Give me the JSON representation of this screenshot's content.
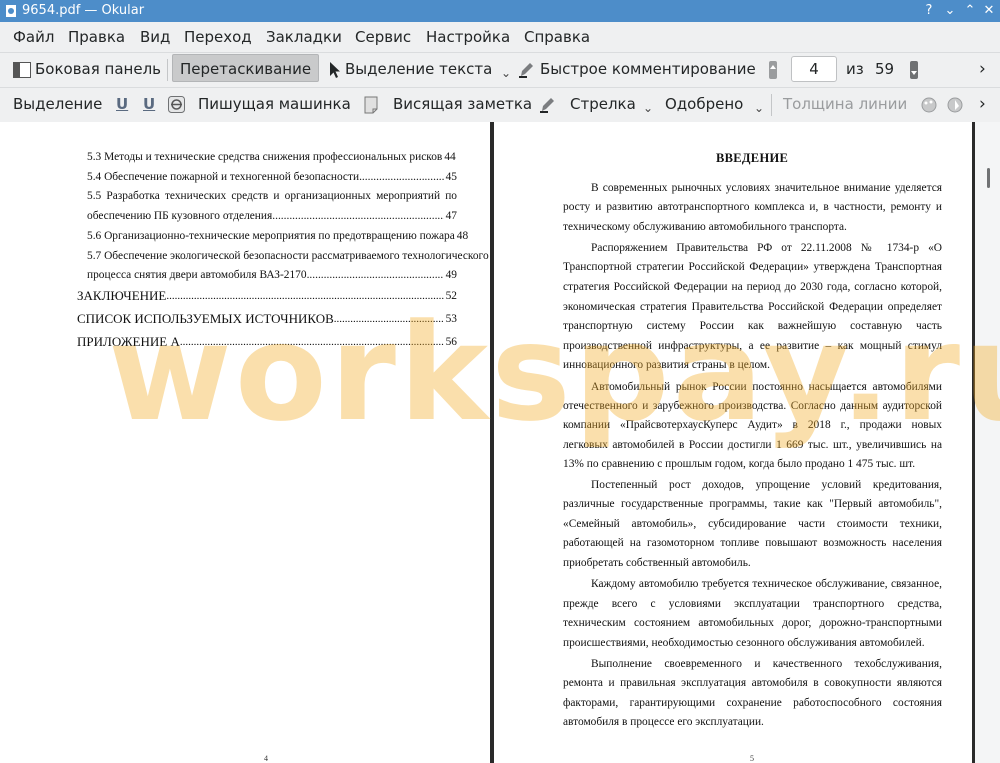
{
  "window": {
    "title": "9654.pdf  — Okular",
    "help_button": "?",
    "minimize": "⌄",
    "maximize": "⌃",
    "close": "✕"
  },
  "menu": [
    "Файл",
    "Правка",
    "Вид",
    "Переход",
    "Закладки",
    "Сервис",
    "Настройка",
    "Справка"
  ],
  "toolbar1": {
    "sidebar": "Боковая панель",
    "browse": "Перетаскивание",
    "text_select": "Выделение текста",
    "quick_annotate": "Быстрое комментирование",
    "page_current": "4",
    "page_of": "из",
    "page_total": "59",
    "more": "›"
  },
  "toolbar2": {
    "selection": "Выделение",
    "underline1": "U",
    "underline2": "U",
    "typewriter": "Пишущая машинка",
    "sticky_note": "Висящая заметка",
    "arrow": "Стрелка",
    "stamp": "Одобрено",
    "line_width": "Толщина линии",
    "more": "›"
  },
  "left_page": {
    "toc": [
      {
        "title": "5.3 Методы и технические средства снижения профессиональных рисков",
        "page": "44"
      },
      {
        "title": "5.4 Обеспечение пожарной и техногенной безопасности",
        "page": "45"
      },
      {
        "title_line1": "5.5 Разработка технических средств и организационных мероприятий по",
        "title": "обеспечению ПБ кузовного отделения",
        "page": "47"
      },
      {
        "title": "5.6 Организационно-технические мероприятия по предотвращению пожара",
        "page": "48"
      },
      {
        "title_line1": "5.7 Обеспечение экологической безопасности рассматриваемого технологического",
        "title": "процесса снятия двери автомобиля ВАЗ-2170",
        "page": "49"
      },
      {
        "title": "ЗАКЛЮЧЕНИЕ",
        "page": "52"
      },
      {
        "title": "СПИСОК ИСПОЛЬЗУЕМЫХ ИСТОЧНИКОВ",
        "page": "53"
      },
      {
        "title": "ПРИЛОЖЕНИЕ А",
        "page": "56"
      }
    ],
    "page_number": "4"
  },
  "right_page": {
    "heading": "ВВЕДЕНИЕ",
    "lines": [
      "В современных рыночных условиях значительное внимание уделяется",
      "росту и развитию автотранспортного комплекса и, в частности, ремонту и",
      "техническому обслуживанию автомобильного транспорта.",
      "Распоряжением Правительства РФ от 22.11.2008 № 1734-р «О",
      "Транспортной стратегии Российской Федерации» утверждена Транспортная",
      "стратегия Российской Федерации на период до 2030 года, согласно которой,",
      "экономическая стратегия Правительства Российской Федерации определяет",
      "транспортную систему России как важнейшую составную часть",
      "производственной инфраструктуры, а ее развитие – как мощный стимул",
      "инновационного развития страны в целом.",
      "Автомобильный рынок России постоянно насыщается автомобилями",
      "отечественного и зарубежного производства. Согласно данным аудиторской",
      "компании «ПрайсвотерхаусКуперс Аудит» в 2018 г., продажи новых",
      "легковых автомобилей в России достигли 1 669 тыс. шт., увеличившись на",
      "13% по сравнению с прошлым годом, когда было продано 1 475 тыс. шт.",
      "Постепенный рост доходов, упрощение условий кредитования,",
      "различные государственные программы, такие как \"Первый автомобиль\",",
      "«Семейный автомобиль», субсидирование части стоимости техники,",
      "работающей на газомоторном топливе повышают возможность населения",
      "приобретать собственный автомобиль.",
      "Каждому автомобилю требуется техническое обслуживание, связанное,",
      "прежде всего с условиями эксплуатации транспортного средства,",
      "техническим состоянием автомобильных дорог, дорожно-транспортными",
      "происшествиями, необходимостью сезонного обслуживания автомобилей.",
      "Выполнение своевременного и качественного техобслуживания,",
      "ремонта и правильная эксплуатация автомобиля в совокупности являются",
      "факторами, гарантирующими сохранение работоспособного состояния",
      "автомобиля в процессе его эксплуатации."
    ],
    "page_number": "5"
  },
  "watermark": "workspay.ru"
}
